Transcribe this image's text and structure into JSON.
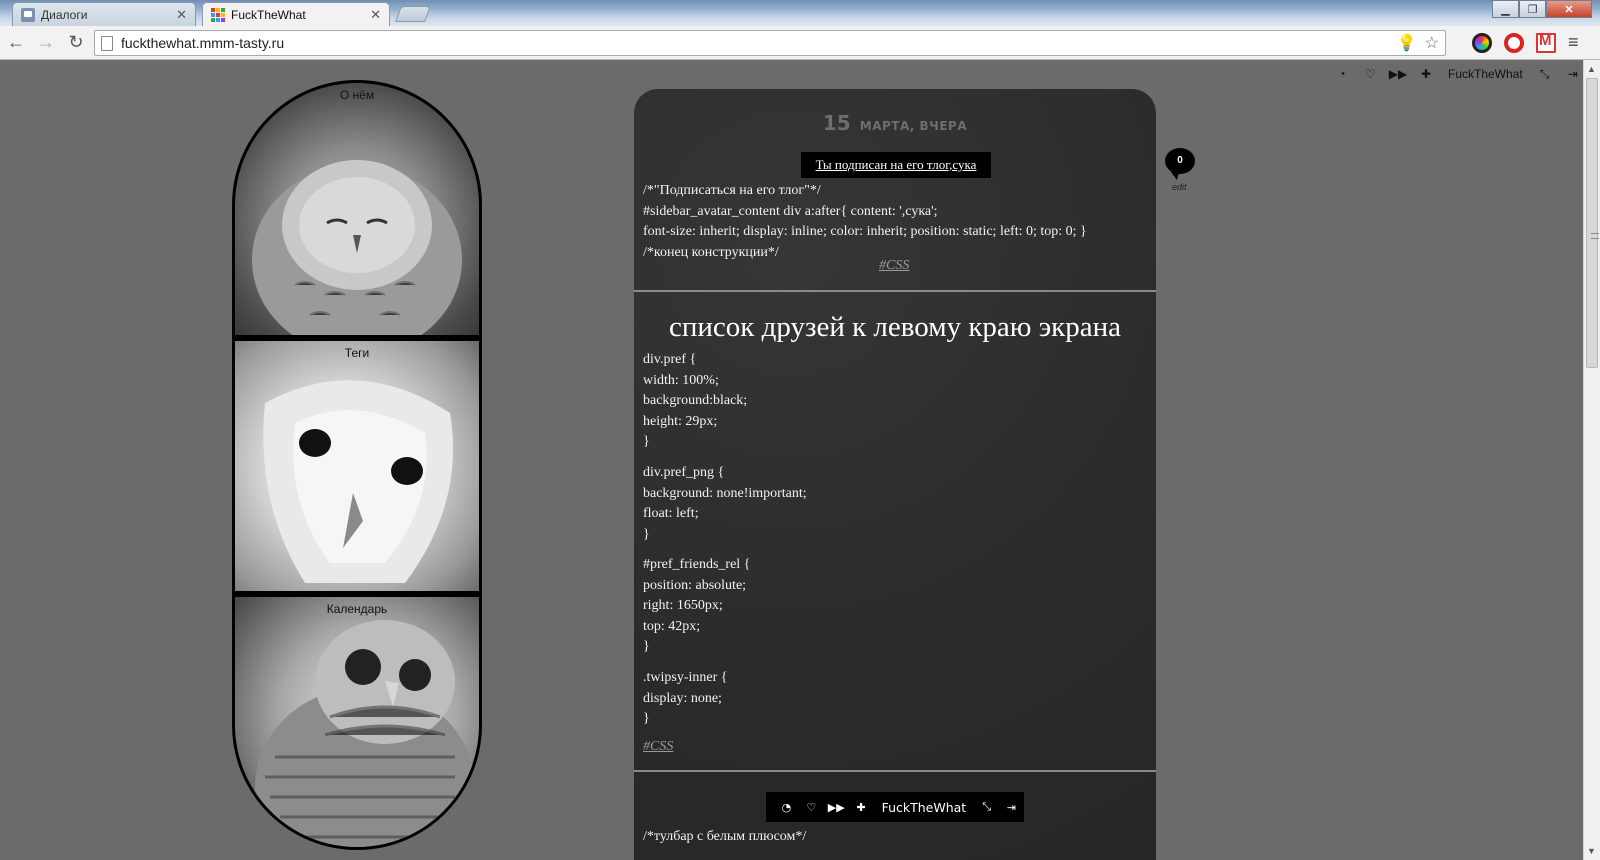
{
  "browser": {
    "tabs": [
      {
        "label": "Диалоги",
        "active": false
      },
      {
        "label": "FuckTheWhat",
        "active": true
      }
    ],
    "url": "fuckthewhat.mmm-tasty.ru"
  },
  "topbar": {
    "username": "FuckTheWhat",
    "icons": [
      "rss-icon",
      "heart-icon",
      "fast-forward-icon",
      "plus-cross-icon",
      "settings-icon",
      "logout-icon"
    ]
  },
  "sidebar": {
    "panels": [
      {
        "label": "О нём"
      },
      {
        "label": "Теги"
      },
      {
        "label": "Календарь"
      }
    ]
  },
  "main": {
    "date_day": "15",
    "date_text": "МАРТА, ВЧЕРА",
    "subscribe_label": "Ты подписан на его тлог,сука",
    "post1_text": "/*\"Подписаться на его тлог\"*/\n#sidebar_avatar_content div a:after{ content: ',сука';\nfont-size: inherit; display: inline; color: inherit; position: static; left: 0; top: 0; }\n/*конец конструкции*/",
    "post1_tag": "#CSS",
    "post2_title": "список друзей к левому краю экрана",
    "post2_blocks": [
      "div.pref {\nwidth: 100%;\nbackground:black;\nheight: 29px;\n}",
      "div.pref_png {\nbackground: none!important;\nfloat: left;\n}",
      "#pref_friends_rel {\nposition: absolute;\nright: 1650px;\ntop: 42px;\n}",
      ".twipsy-inner {\ndisplay: none;\n}"
    ],
    "post2_tag": "#CSS",
    "post3_toolbar_name": "FuckTheWhat",
    "post3_text": "/*тулбар с белым плюсом*/"
  },
  "comments": {
    "count": "0",
    "edit_label": "edit"
  }
}
